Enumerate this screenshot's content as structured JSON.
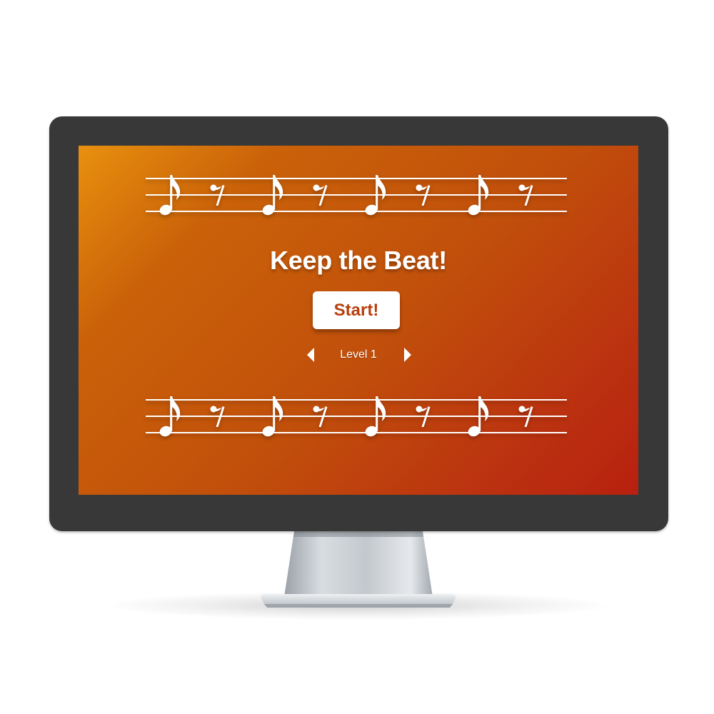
{
  "game": {
    "title": "Keep the Beat!",
    "start_label": "Start!",
    "level_label": "Level 1",
    "level_value": 1
  },
  "staff": {
    "pattern": [
      "eighth-note",
      "eighth-rest",
      "eighth-note",
      "eighth-rest",
      "eighth-note",
      "eighth-rest",
      "eighth-note",
      "eighth-rest"
    ],
    "line_count": 3
  },
  "icons": {
    "prev": "chevron-left-icon",
    "next": "chevron-right-icon",
    "note": "eighth-note-icon",
    "rest": "eighth-rest-icon"
  },
  "colors": {
    "screen_gradient_start": "#e8900e",
    "screen_gradient_end": "#b8200f",
    "bezel": "#383838",
    "start_text": "#b8400f",
    "foreground": "#ffffff"
  }
}
